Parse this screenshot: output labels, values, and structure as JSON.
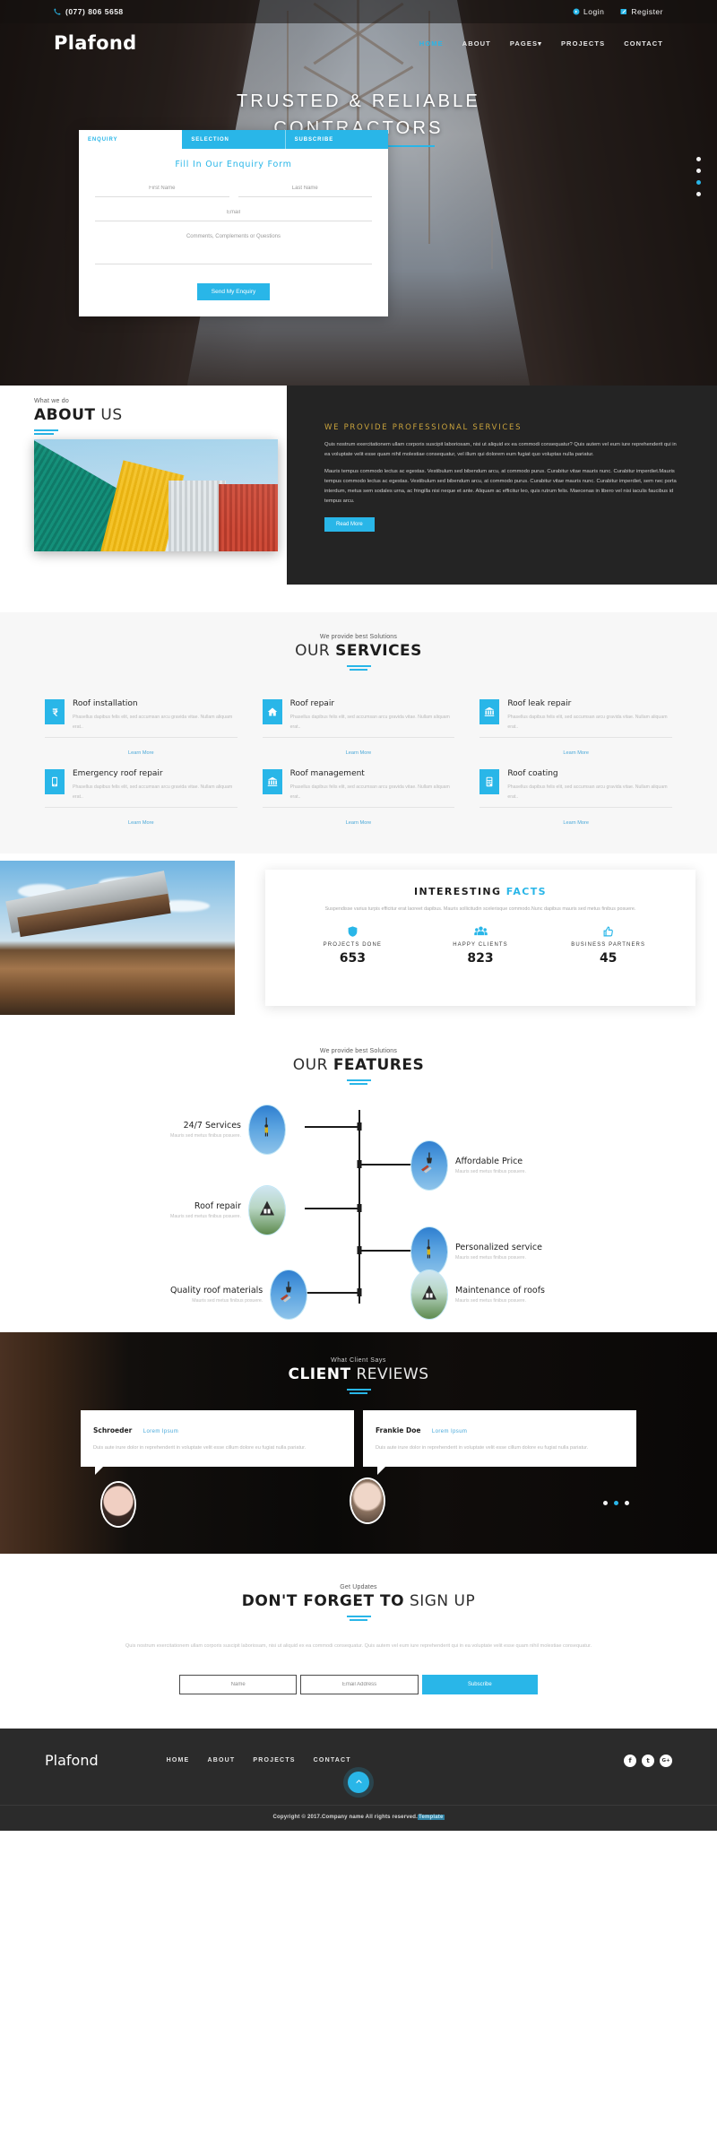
{
  "brand": "Plafond",
  "accent": "#29b6e8",
  "topbar": {
    "phone": "(077) 806 5658",
    "login": "Login",
    "register": "Register"
  },
  "nav": [
    {
      "label": "HOME",
      "active": true
    },
    {
      "label": "ABOUT",
      "active": false
    },
    {
      "label": "PAGES",
      "active": false,
      "caret": true
    },
    {
      "label": "PROJECTS",
      "active": false
    },
    {
      "label": "CONTACT",
      "active": false
    }
  ],
  "hero": {
    "title_line1": "TRUSTED & RELIABLE",
    "title_line2": "CONTRACTORS",
    "dots": [
      false,
      false,
      true,
      false
    ]
  },
  "enquiry": {
    "tabs": [
      {
        "label": "ENQUIRY",
        "active": true
      },
      {
        "label": "SELECTION",
        "active": false
      },
      {
        "label": "SUBSCRIBE",
        "active": false
      }
    ],
    "heading": "Fill In Our Enquiry Form",
    "first_name_placeholder": "First Name",
    "last_name_placeholder": "Last Name",
    "email_placeholder": "Email",
    "comments_placeholder": "Comments, Complements or Questions",
    "submit_label": "Send My Enquiry"
  },
  "about": {
    "kicker": "What we do",
    "title_bold": "ABOUT",
    "title_light": "US",
    "heading": "WE PROVIDE PROFESSIONAL SERVICES",
    "paragraph1": "Quis nostrum exercitationem ullam corporis suscipit laboriosam, nisi ut aliquid ex ea commodi consequatur? Quis autem vel eum iure reprehenderit qui in ea voluptate velit esse quam nihil molestiae consequatur, vel illum qui dolorem eum fugiat quo voluptas nulla pariatur.",
    "paragraph2": "Mauris tempus commodo lectus ac egestas. Vestibulum sed bibendum arcu, at commodo purus. Curabitur vitae mauris nunc. Curabitur imperdiet.Mauris tempus commodo lectus ac egestas. Vestibulum sed bibendum arcu, at commodo purus. Curabitur vitae mauris nunc. Curabitur imperdiet, sem nec porta interdum, metus sem sodales urna, ac fringilla nisi neque et ante. Aliquam ac efficitur leo, quis rutrum felis. Maecenas in libero vel nisi iaculis faucibus id tempus arcu.",
    "button": "Read More"
  },
  "services": {
    "kicker": "We provide best Solutions",
    "title_light": "OUR",
    "title_bold": "SERVICES",
    "learn_more": "Learn More",
    "body_text": "Phasellus dapibus felis elit, sed accumsan arcu gravida vitae. Nullam aliquam erat..",
    "items": [
      {
        "title": "Roof installation",
        "icon": "rupee-icon"
      },
      {
        "title": "Roof repair",
        "icon": "home-icon"
      },
      {
        "title": "Roof leak repair",
        "icon": "bank-icon"
      },
      {
        "title": "Emergency roof repair",
        "icon": "mobile-icon"
      },
      {
        "title": "Roof management",
        "icon": "bank-icon"
      },
      {
        "title": "Roof coating",
        "icon": "calculator-icon"
      }
    ]
  },
  "facts": {
    "title_bold": "INTERESTING",
    "title_accent": "FACTS",
    "paragraph": "Suspendisse varius turpis efficitur erat laoreet dapibus. Mauris sollicitudin scelerisque commodo.Nunc dapibus mauris sed metus finibus posuere.",
    "stats": [
      {
        "label": "PROJECTS DONE",
        "value": "653",
        "icon": "shield-icon"
      },
      {
        "label": "HAPPY CLIENTS",
        "value": "823",
        "icon": "users-icon"
      },
      {
        "label": "BUSINESS PARTNERS",
        "value": "45",
        "icon": "thumbs-up-icon"
      }
    ]
  },
  "features": {
    "kicker": "We provide best Solutions",
    "title_light": "OUR",
    "title_bold": "FEATURES",
    "sub": "Mauris sed metus finibus posuere.",
    "left": [
      {
        "title": "24/7 Services",
        "sub": "Mauris sed metus finibus posuere.",
        "avatar": "worker-icon"
      },
      {
        "title": "Roof repair",
        "sub": "Mauris sed metus finibus posuere.",
        "avatar": "cottage-icon"
      },
      {
        "title": "Quality roof materials",
        "sub": "Mauris sed metus finibus posuere.",
        "avatar": "lamp-icon"
      }
    ],
    "right": [
      {
        "title": "Affordable Price",
        "sub": "Mauris sed metus finibus posuere.",
        "avatar": "lamp-icon"
      },
      {
        "title": "Personalized service",
        "sub": "Mauris sed metus finibus posuere.",
        "avatar": "worker-icon"
      },
      {
        "title": "Maintenance of roofs",
        "sub": "Mauris sed metus finibus posuere.",
        "avatar": "cottage-icon"
      }
    ]
  },
  "reviews": {
    "kicker": "What Client Says",
    "title_bold": "CLIENT",
    "title_light": "REVIEWS",
    "items": [
      {
        "name": "Schroeder",
        "role": "Lorem Ipsum",
        "body": "Duis aute irure dolor in reprehenderit in voluptate velit esse cillum dolore eu fugiat nulla pariatur."
      },
      {
        "name": "Frankie Doe",
        "role": "Lorem Ipsum",
        "body": "Duis aute irure dolor in reprehenderit in voluptate velit esse cillum dolore eu fugiat nulla pariatur."
      }
    ],
    "dots": [
      false,
      true,
      false
    ]
  },
  "signup": {
    "kicker": "Get Updates",
    "title_bold": "DON'T FORGET TO",
    "title_light": "SIGN UP",
    "paragraph": "Quis nostrum exercitationem ullam corporis suscipit laboriosam, nisi ut aliquid ex ea commodi consequatur. Quis autem vel eum iure reprehenderit qui in ea voluptate velit esse quam nihil molestiae consequatur.",
    "name_placeholder": "Name",
    "email_placeholder": "Email Address",
    "submit_label": "Subscribe"
  },
  "footer": {
    "brand": "Plafond",
    "nav": [
      "HOME",
      "ABOUT",
      "PROJECTS",
      "CONTACT"
    ],
    "social": [
      {
        "name": "facebook-icon",
        "glyph": "f"
      },
      {
        "name": "twitter-icon",
        "glyph": "t"
      },
      {
        "name": "google-plus-icon",
        "glyph": "G+"
      }
    ],
    "copyright": "Copyright © 2017.Company name All rights reserved.",
    "copyright_credit": "Template"
  }
}
